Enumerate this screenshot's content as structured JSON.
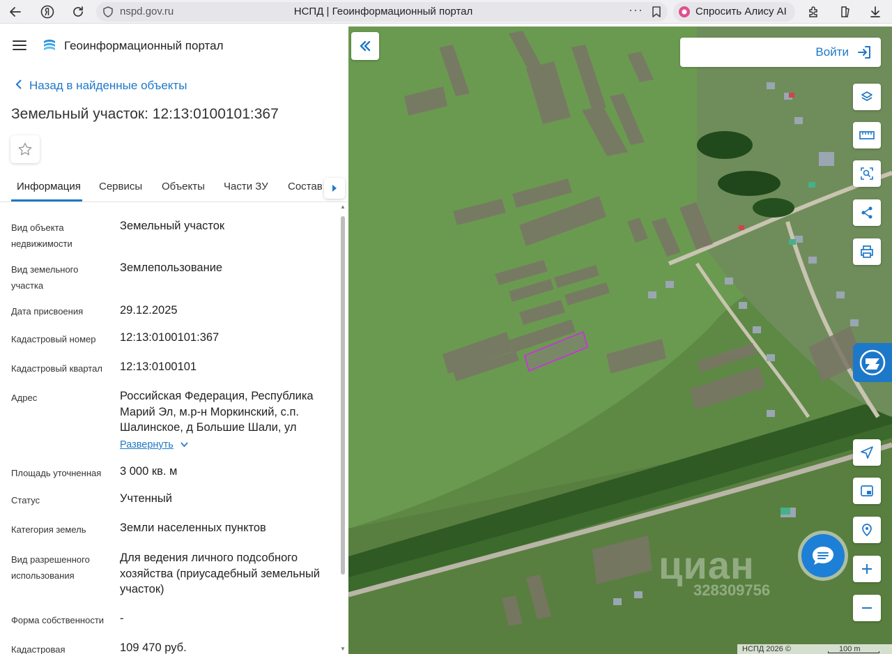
{
  "browser": {
    "url": "nspd.gov.ru",
    "tab_title": "НСПД | Геоинформационный портал",
    "more": "···",
    "alice_label": "Спросить Алису AI"
  },
  "header": {
    "portal_title": "Геоинформационный портал"
  },
  "back_link": "Назад в найденные объекты",
  "page_title": "Земельный участок: 12:13:0100101:367",
  "tabs": [
    {
      "label": "Информация"
    },
    {
      "label": "Сервисы"
    },
    {
      "label": "Объекты"
    },
    {
      "label": "Части ЗУ"
    },
    {
      "label": "Состав"
    }
  ],
  "properties": [
    {
      "label": "Вид объекта недвижимости",
      "value": "Земельный участок"
    },
    {
      "label": "Вид земельного участка",
      "value": "Землепользование"
    },
    {
      "label": "Дата присвоения",
      "value": "29.12.2025"
    },
    {
      "label": "Кадастровый номер",
      "value": "12:13:0100101:367"
    },
    {
      "label": "Кадастровый квартал",
      "value": "12:13:0100101"
    },
    {
      "label": "Адрес",
      "value": "Российская Федерация, Республика Марий Эл, м.р-н Моркинский, с.п. Шалинское, д Большие Шали, ул"
    },
    {
      "label": "Площадь уточненная",
      "value": "3 000 кв. м"
    },
    {
      "label": "Статус",
      "value": "Учтенный"
    },
    {
      "label": "Категория земель",
      "value": "Земли населенных пунктов"
    },
    {
      "label": "Вид разрешенного использования",
      "value": "Для ведения личного подсобного хозяйства (приусадебный земельный участок)"
    },
    {
      "label": "Форма собственности",
      "value": "-"
    },
    {
      "label": "Кадастровая",
      "value": "109 470 руб."
    }
  ],
  "expand_label": "Развернуть",
  "map": {
    "login_label": "Войти",
    "watermark": "циан",
    "watermark_number": "328309756",
    "copyright": "НСПД 2026 ©",
    "scale_label": "100 m",
    "highlight_color": "#c03bd0",
    "accent_color": "#1e78c8"
  }
}
